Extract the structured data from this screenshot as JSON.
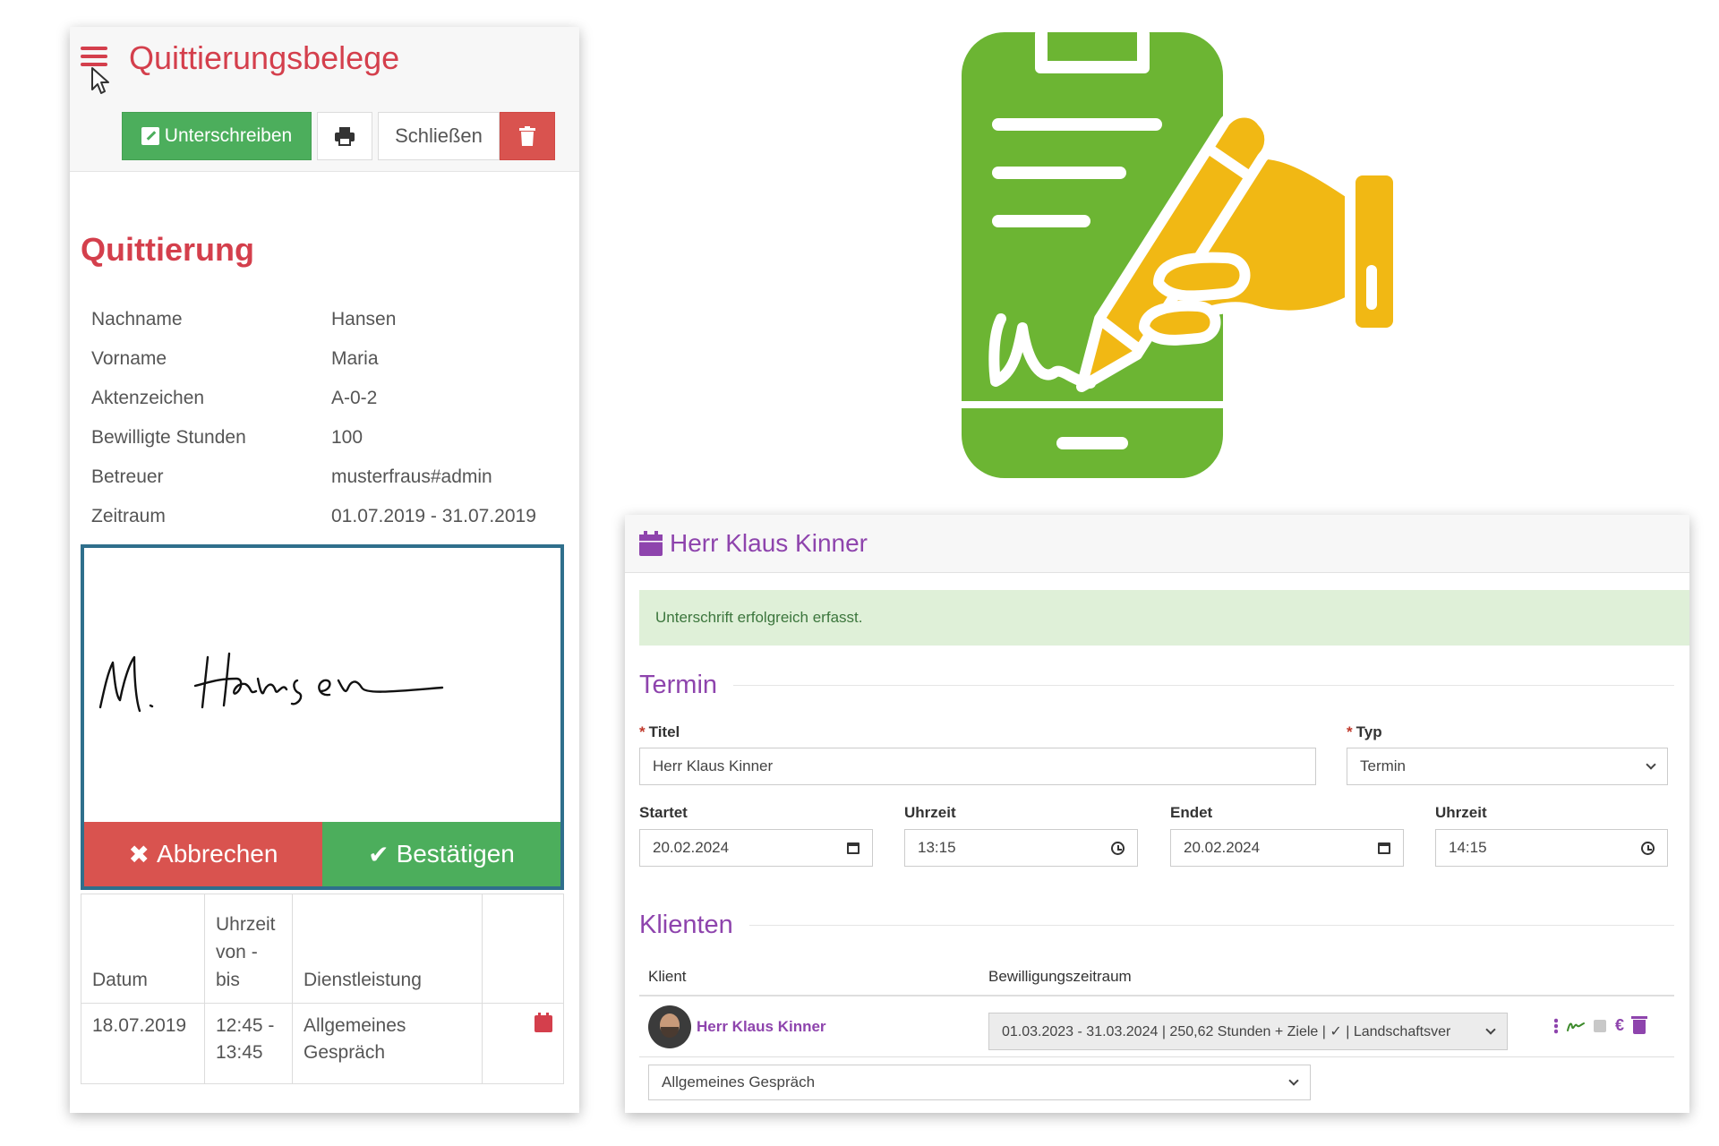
{
  "left": {
    "title": "Quittierungsbelege",
    "toolbar": {
      "sign_label": "Unterschreiben",
      "close_label": "Schließen"
    },
    "section_title": "Quittierung",
    "info": [
      {
        "k": "Nachname",
        "v": "Hansen"
      },
      {
        "k": "Vorname",
        "v": "Maria"
      },
      {
        "k": "Aktenzeichen",
        "v": "A-0-2"
      },
      {
        "k": "Bewilligte Stunden",
        "v": "100"
      },
      {
        "k": "Betreuer",
        "v": "musterfraus#admin"
      },
      {
        "k": "Zeitraum",
        "v": "01.07.2019 - 31.07.2019"
      }
    ],
    "signature": {
      "cancel_label": "Abbrechen",
      "confirm_label": "Bestätigen"
    },
    "table": {
      "headers": [
        "Datum",
        "Uhrzeit von - bis",
        "Dienstleistung",
        ""
      ],
      "rows": [
        {
          "datum": "18.07.2019",
          "uhrzeit": "12:45 - 13:45",
          "dienstleistung": "Allgemeines Gespräch"
        }
      ]
    }
  },
  "right": {
    "title": "Herr Klaus Kinner",
    "alert": "Unterschrift erfolgreich erfasst.",
    "termin_legend": "Termin",
    "titel_label": "Titel",
    "titel_value": "Herr Klaus Kinner",
    "typ_label": "Typ",
    "typ_value": "Termin",
    "startet_label": "Startet",
    "startet_value": "20.02.2024",
    "uhrzeit1_label": "Uhrzeit",
    "uhrzeit1_value": "13:15",
    "endet_label": "Endet",
    "endet_value": "20.02.2024",
    "uhrzeit2_label": "Uhrzeit",
    "uhrzeit2_value": "14:15",
    "klienten_legend": "Klienten",
    "col_klient": "Klient",
    "col_bewilligung": "Bewilligungszeitraum",
    "klient_name": "Herr Klaus Kinner",
    "bewilligung_value": "01.03.2023 - 31.03.2024 | 250,62 Stunden + Ziele | ✓ | Landschaftsver",
    "dienstleistung_value": "Allgemeines Gespräch",
    "euro_symbol": "€"
  },
  "colors": {
    "brand_red": "#d43f4c",
    "success_green": "#4cae5c",
    "danger_red": "#d9534f",
    "purple": "#8e44ad",
    "phone_green": "#6cb533",
    "hand_yellow": "#f1b814",
    "alert_bg": "#dff0d8"
  },
  "icons": [
    "hamburger-icon",
    "cursor-icon",
    "edit-icon",
    "print-icon",
    "trash-icon",
    "calendar-icon",
    "phone-signature-illustration",
    "chevron-down-icon",
    "date-picker-icon",
    "clock-icon",
    "more-dots-icon",
    "signature-icon",
    "euro-icon"
  ]
}
